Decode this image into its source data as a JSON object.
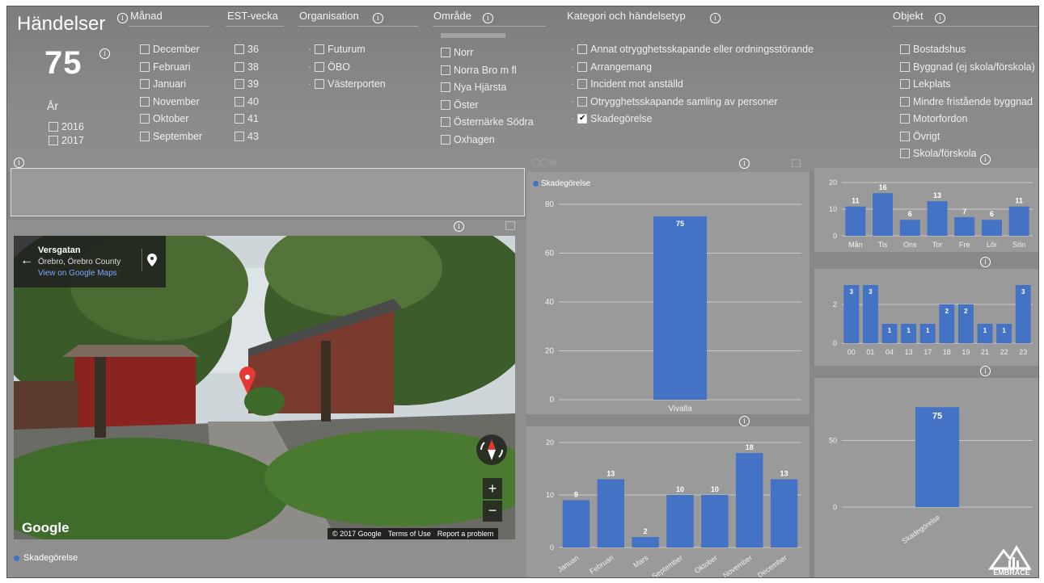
{
  "header": {
    "title": "Händelser",
    "count": "75"
  },
  "year": {
    "title": "År",
    "items": [
      "2016",
      "2017"
    ]
  },
  "month": {
    "title": "Månad",
    "items": [
      "December",
      "Februari",
      "Januari",
      "November",
      "Oktober",
      "September"
    ]
  },
  "week": {
    "title": "EST-vecka",
    "items": [
      "36",
      "38",
      "39",
      "40",
      "41",
      "43"
    ]
  },
  "org": {
    "title": "Organisation",
    "items": [
      "Futurum",
      "ÖBO",
      "Västerporten"
    ]
  },
  "area": {
    "title": "Område",
    "items": [
      "Norr",
      "Norra Bro m fl",
      "Nya Hjärsta",
      "Öster",
      "Östernärke Södra",
      "Oxhagen"
    ]
  },
  "category": {
    "title": "Kategori och händelsetyp",
    "items": [
      {
        "label": "Annat otrygghetsskapande eller ordningsstörande",
        "checked": false
      },
      {
        "label": "Arrangemang",
        "checked": false
      },
      {
        "label": "Incident mot anställd",
        "checked": false
      },
      {
        "label": "Otrygghetsskapande samling av personer",
        "checked": false
      },
      {
        "label": "Skadegörelse",
        "checked": true
      }
    ]
  },
  "object": {
    "title": "Objekt",
    "items": [
      "Bostadshus",
      "Byggnad (ej skola/förskola)",
      "Lekplats",
      "Mindre fristående byggnad",
      "Motorfordon",
      "Övrigt",
      "Skola/förskola"
    ]
  },
  "map": {
    "street": "Versgatan",
    "place": "Örebro, Örebro County",
    "link": "View on Google Maps",
    "brand": "Google",
    "copyright": "© 2017 Google",
    "terms": "Terms of Use",
    "report": "Report a problem",
    "legend": "Skadegörelse"
  },
  "colors": {
    "bar": "#4472c4",
    "panel": "#9a9a9a"
  },
  "chart_data": [
    {
      "type": "bar",
      "legend": [
        "Skadegörelse"
      ],
      "categories": [
        "Vivalla"
      ],
      "values": [
        75
      ],
      "ylim": [
        0,
        80
      ],
      "yticks": [
        0,
        20,
        40,
        60,
        80
      ]
    },
    {
      "type": "bar",
      "categories": [
        "Januari",
        "Februari",
        "Mars",
        "September",
        "Oktober",
        "November",
        "December"
      ],
      "values": [
        9,
        13,
        2,
        10,
        10,
        18,
        13
      ],
      "ylim": [
        0,
        20
      ],
      "yticks": [
        0,
        10,
        20
      ]
    },
    {
      "type": "bar",
      "categories": [
        "Mån",
        "Tis",
        "Ons",
        "Tor",
        "Fre",
        "Lör",
        "Sön"
      ],
      "values": [
        11,
        16,
        6,
        13,
        7,
        6,
        11
      ],
      "ylim": [
        0,
        20
      ],
      "yticks": [
        0,
        10,
        20
      ]
    },
    {
      "type": "bar",
      "categories": [
        "00",
        "01",
        "04",
        "13",
        "17",
        "18",
        "19",
        "21",
        "22",
        "23"
      ],
      "values": [
        3,
        3,
        1,
        1,
        1,
        2,
        2,
        1,
        1,
        3
      ],
      "ylim": [
        0,
        3
      ],
      "yticks": [
        0,
        2
      ]
    },
    {
      "type": "bar",
      "categories": [
        "Skadegörelse"
      ],
      "values": [
        75
      ],
      "ylim": [
        0,
        80
      ],
      "yticks": [
        0,
        50
      ]
    }
  ]
}
